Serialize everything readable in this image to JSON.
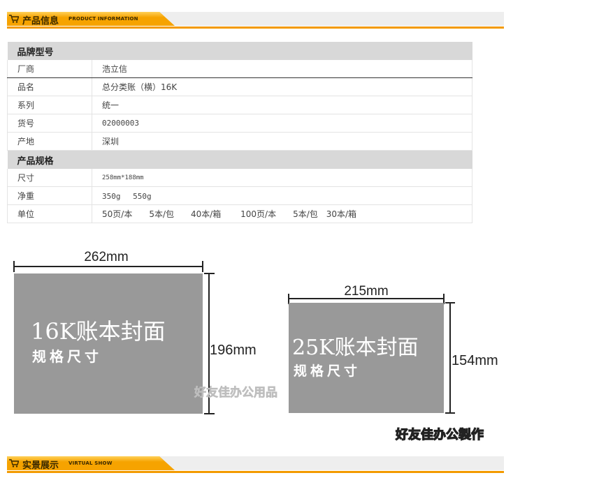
{
  "sections": {
    "product_info": {
      "cn": "产品信息",
      "en": "PRODUCT INFORMATION"
    },
    "virtual_show": {
      "cn": "实景展示",
      "en": "VIRTUAL SHOW"
    }
  },
  "spec": {
    "brand_header": "品牌型号",
    "brand_rows": [
      {
        "k": "厂商",
        "v": "浩立信"
      },
      {
        "k": "品名",
        "v": "总分类账（横）16K"
      },
      {
        "k": "系列",
        "v": "统一"
      },
      {
        "k": "货号",
        "v": "02000003"
      },
      {
        "k": "产地",
        "v": "深圳"
      }
    ],
    "spec_header": "产品规格",
    "spec_rows": [
      {
        "k": "尺寸",
        "v": "258mm*188mm"
      },
      {
        "k": "净重",
        "v": "350g　 550g"
      },
      {
        "k": "单位",
        "v": "50页/本　　5本/包　　40本/箱　　 100页/本　　5本/包　30本/箱"
      }
    ]
  },
  "diagram": {
    "left": {
      "width_label": "262mm",
      "height_label": "196mm",
      "title": "16K账本封面",
      "subtitle": "规格尺寸"
    },
    "right": {
      "width_label": "215mm",
      "height_label": "154mm",
      "title": "25K账本封面",
      "subtitle": "规格尺寸"
    },
    "watermark_center": "好友佳办公用品",
    "watermark_corner": "好友佳办公製作"
  },
  "colors": {
    "banner_orange": "#f6a300",
    "banner_line": "#f39a00",
    "cover_gray": "#999999"
  }
}
